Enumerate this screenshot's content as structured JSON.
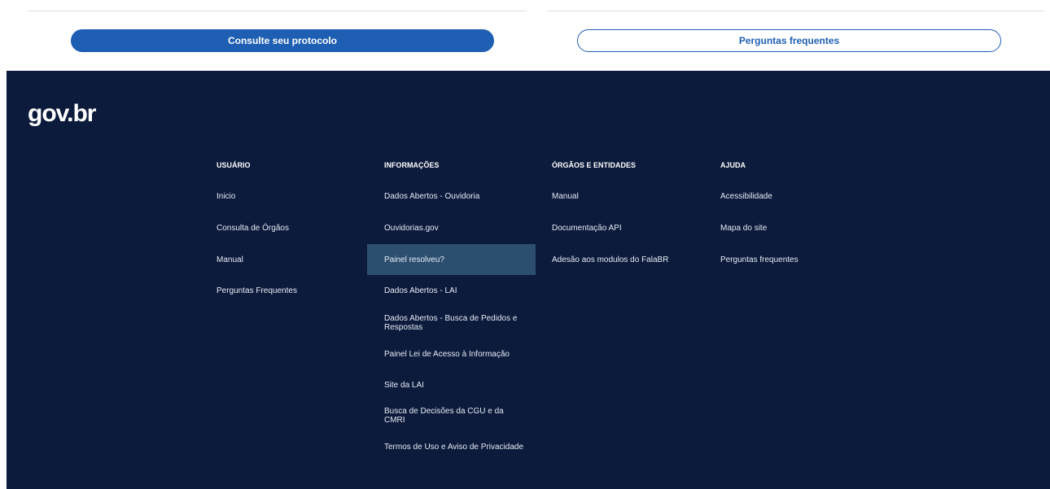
{
  "top": {
    "primary_button": "Consulte seu protocolo",
    "secondary_button": "Perguntas frequentes"
  },
  "footer": {
    "logo": "gov.br",
    "columns": [
      {
        "title": "USUÁRIO",
        "links": [
          "Inicio",
          "Consulta de Órgãos",
          "Manual",
          "Perguntas Frequentes"
        ]
      },
      {
        "title": "INFORMAÇÕES",
        "links": [
          "Dados Abertos - Ouvidoria",
          "Ouvidorias.gov",
          "Painel resolveu?",
          "Dados Abertos - LAI",
          "Dados Abertos - Busca de Pedidos e Respostas",
          "Painel Lei de Acesso à Informação",
          "Site da LAI",
          "Busca de Decisões da CGU e da CMRI",
          "Termos de Uso e Aviso de Privacidade"
        ]
      },
      {
        "title": "ÓRGÃOS E ENTIDADES",
        "links": [
          "Manual",
          "Documentação API",
          "Adesão aos modulos do FalaBR"
        ]
      },
      {
        "title": "AJUDA",
        "links": [
          "Acessibilidade",
          "Mapa do site",
          "Perguntas frequentes"
        ]
      }
    ]
  }
}
